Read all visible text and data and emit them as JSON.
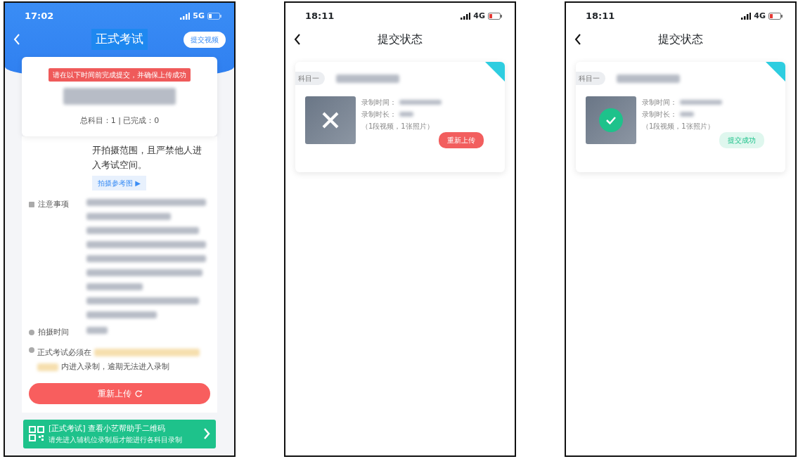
{
  "phones": [
    {
      "kind": "exam",
      "status_bar": {
        "time": "17:02",
        "network": "5G"
      },
      "title": "正式考试",
      "action": "提交视频",
      "notice": "请在以下时间前完成提交，并确保上传成功",
      "progress": "总科目：1 | 已完成：0",
      "instruction": "开拍摄范围，且严禁他人进入考试空间。",
      "reference_link": "拍摄参考图 ▶",
      "notes_label": "注意事项",
      "time_label": "拍摄时间",
      "deadline_prefix": "正式考试必须在",
      "deadline_suffix": "内进入录制，逾期无法进入录制",
      "reupload": "重新上传",
      "banner": {
        "title": "[正式考试] 查看小艺帮助手二维码",
        "subtitle": "请先进入辅机位录制后才能进行各科目录制"
      }
    },
    {
      "kind": "status",
      "status_bar": {
        "time": "18:11",
        "network": "4G"
      },
      "title": "提交状态",
      "subject_tag": "科目一",
      "record_time_label": "录制时间：",
      "duration_label": "录制时长：",
      "counts": "（1段视频，1张照片）",
      "submitted": false,
      "action": "重新上传"
    },
    {
      "kind": "status",
      "status_bar": {
        "time": "18:11",
        "network": "4G"
      },
      "title": "提交状态",
      "subject_tag": "科目一",
      "record_time_label": "录制时间：",
      "duration_label": "录制时长：",
      "counts": "（1段视频，1张照片）",
      "submitted": true,
      "action": "提交成功"
    }
  ]
}
